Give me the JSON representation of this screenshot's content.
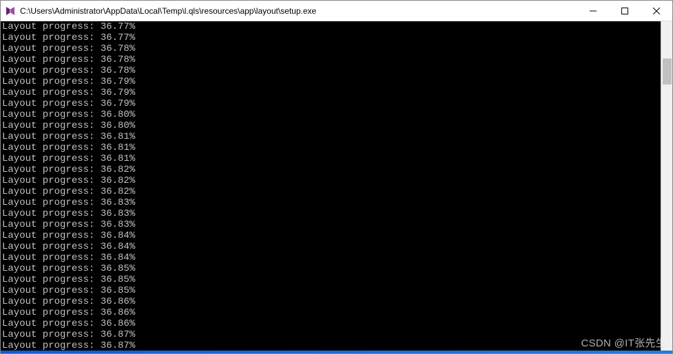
{
  "window": {
    "title": "C:\\Users\\Administrator\\AppData\\Local\\Temp\\l.qls\\resources\\app\\layout\\setup.exe"
  },
  "console": {
    "label_prefix": "Layout progress: ",
    "lines": [
      "Layout progress: 36.77%",
      "Layout progress: 36.77%",
      "Layout progress: 36.78%",
      "Layout progress: 36.78%",
      "Layout progress: 36.78%",
      "Layout progress: 36.79%",
      "Layout progress: 36.79%",
      "Layout progress: 36.79%",
      "Layout progress: 36.80%",
      "Layout progress: 36.80%",
      "Layout progress: 36.81%",
      "Layout progress: 36.81%",
      "Layout progress: 36.81%",
      "Layout progress: 36.82%",
      "Layout progress: 36.82%",
      "Layout progress: 36.82%",
      "Layout progress: 36.83%",
      "Layout progress: 36.83%",
      "Layout progress: 36.83%",
      "Layout progress: 36.84%",
      "Layout progress: 36.84%",
      "Layout progress: 36.84%",
      "Layout progress: 36.85%",
      "Layout progress: 36.85%",
      "Layout progress: 36.85%",
      "Layout progress: 36.86%",
      "Layout progress: 36.86%",
      "Layout progress: 36.86%",
      "Layout progress: 36.87%",
      "Layout progress: 36.87%"
    ]
  },
  "watermark": "CSDN @IT张先生"
}
